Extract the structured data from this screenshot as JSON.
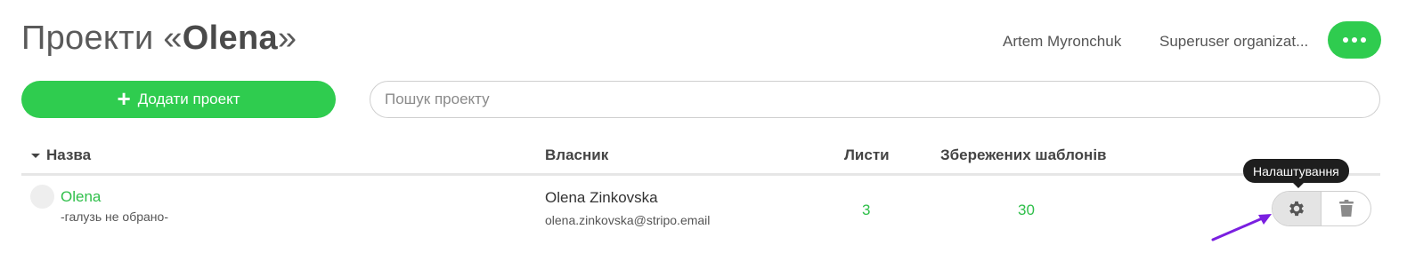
{
  "header": {
    "title_prefix": "Проекти «",
    "title_project": "Olena",
    "title_suffix": "»",
    "user_name": "Artem Myronchuk",
    "organization": "Superuser organizat...",
    "more_icon": "ellipsis-icon"
  },
  "toolbar": {
    "add_label": "Додати проект",
    "add_icon": "plus-icon",
    "search_placeholder": "Пошук проекту",
    "search_value": ""
  },
  "table": {
    "columns": {
      "name": "Назва",
      "owner": "Власник",
      "letters": "Листи",
      "templates": "Збережених шаблонів"
    },
    "rows": [
      {
        "name": "Olena",
        "industry": "-галузь не обрано-",
        "owner_name": "Olena Zinkovska",
        "owner_email": "olena.zinkovska@stripo.email",
        "letters": "3",
        "templates": "30"
      }
    ]
  },
  "tooltip": {
    "text": "Налаштування"
  },
  "colors": {
    "accent": "#2fcc4f",
    "link": "#2fbf4a",
    "annotation_arrow": "#7a1fe0"
  }
}
